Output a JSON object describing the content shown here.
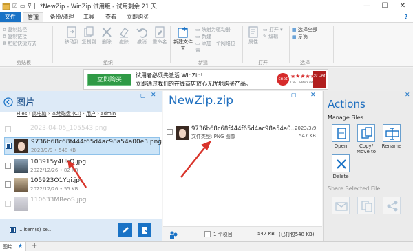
{
  "titlebar": {
    "title": "*NewZip - WinZip 试用版 - 试用剩余 21 天",
    "minimize": "—",
    "maximize": "☐",
    "close": "✕"
  },
  "menu": {
    "tabs": [
      "文件",
      "管理",
      "备份/清理",
      "工具",
      "查看",
      "立即购买"
    ],
    "help": "?"
  },
  "ribbon": {
    "clipboard": {
      "items": [
        "复制路径",
        "复制链接",
        "粘贴快捷方式"
      ],
      "label": "剪贴板"
    },
    "organize": {
      "buttons": [
        "移动到",
        "复制到",
        "删除",
        "撤除",
        "撤消",
        "重命名"
      ],
      "label": "组织"
    },
    "new": {
      "new_folder": "新建文件夹",
      "items": [
        "映射为驱动器",
        "新建",
        "添加一个网络位置"
      ],
      "label": "新建"
    },
    "open": {
      "properties": "属性",
      "items": [
        "打开",
        "编辑"
      ],
      "label": "打开"
    },
    "select": {
      "items": [
        "选择全部",
        "反选"
      ],
      "label": "选择"
    }
  },
  "ad": {
    "button": "立即购买",
    "line1": "试用者必须先激活 WinZip!",
    "line2": "立即通过我们的在线商店放心无忧地购买产品。",
    "badge": "cnet",
    "stars": "★★★★★",
    "rating": "CNET editors rating",
    "seal": "30 DAY"
  },
  "left_pane": {
    "title": "图片",
    "breadcrumb": [
      "Files",
      "此电脑",
      "本地磁盘 (C:)",
      "用户",
      "admin"
    ],
    "files": [
      {
        "name": "2023-04-05_105543.png",
        "meta": ""
      },
      {
        "name": "9736b68c68f444f65d4ac98a54a00e3.png",
        "meta": "2023/3/9 • 548 KB"
      },
      {
        "name": "103915y4UkQ.jpg",
        "meta": "2022/12/26 • 82 KB"
      },
      {
        "name": "105923O1Yqi.jpg",
        "meta": "2022/12/26 • 55 KB"
      },
      {
        "name": "110633MReoS.jpg",
        "meta": ""
      }
    ],
    "selection_status": "1 item(s) se..."
  },
  "center": {
    "title": "NewZip.zip",
    "file": {
      "name": "9736b68c68f444f65d4ac98a54a0...",
      "type": "文件类型: PNG 图像",
      "date": "2023/3/9",
      "size": "547 KB"
    },
    "footer": {
      "count": "1 个项目",
      "size": "547 KB",
      "packed": "(已打包548 KB)"
    }
  },
  "actions": {
    "title": "Actions",
    "manage_heading": "Manage Files",
    "buttons": [
      "Open",
      "Copy/ Move to",
      "Rename",
      "Delete"
    ],
    "share_heading": "Share Selected File"
  },
  "statusbar": {
    "tab": "图片",
    "star": "★",
    "add": "+"
  },
  "colors": {
    "accent": "#1a73c6",
    "title_blue": "#1f6fbf",
    "arrow_red": "#d9342b",
    "selection": "#cce4f7"
  }
}
